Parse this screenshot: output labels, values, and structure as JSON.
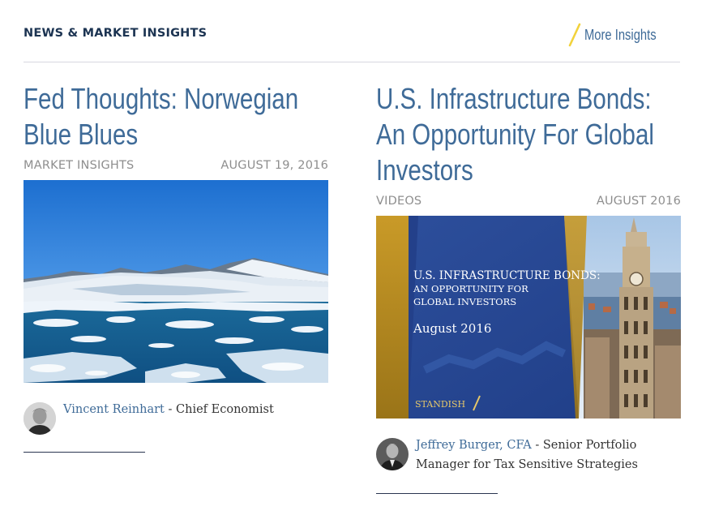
{
  "header": {
    "title": "NEWS & MARKET INSIGHTS",
    "more_label": "More Insights",
    "slash_icon": "slash-icon"
  },
  "colors": {
    "link": "#3f6b98",
    "title_dark": "#1c3452",
    "meta": "#8e8e8e",
    "accent_yellow": "#f2d23c"
  },
  "cards": [
    {
      "title": "Fed Thoughts: Norwegian Blue Blues",
      "category": "MARKET INSIGHTS",
      "date": "AUGUST 19, 2016",
      "image": "glacier-lagoon-photo",
      "author": {
        "name": "Vincent Reinhart",
        "role": "- Chief Economist"
      }
    },
    {
      "title": "U.S. Infrastructure Bonds: An Opportunity For Global Investors",
      "category": "VIDEOS",
      "date": "AUGUST 2016",
      "image": "video-title-slide",
      "video_slide": {
        "line1": "U.S. INFRASTRUCTURE BONDS:",
        "line2": "AN OPPORTUNITY FOR",
        "line3": "GLOBAL INVESTORS",
        "date": "August 2016",
        "brand": "STANDISH"
      },
      "author": {
        "name": "Jeffrey Burger, CFA",
        "role": "- Senior Portfolio Manager for Tax Sensitive Strategies"
      }
    }
  ]
}
